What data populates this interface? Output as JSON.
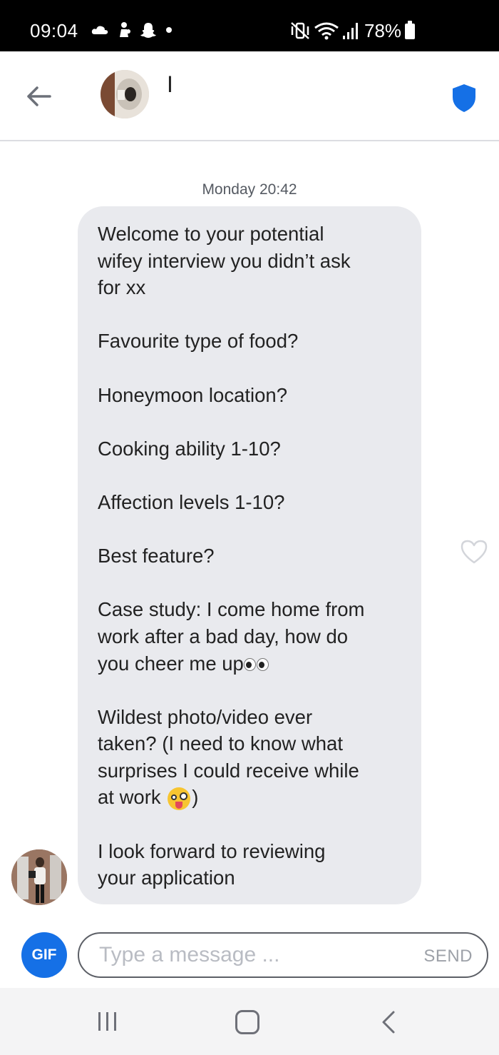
{
  "status_bar": {
    "time": "09:04",
    "battery": "78%",
    "left_icons": [
      "cloud-icon",
      "figure-icon",
      "snapchat-ghost-icon",
      "dot-icon"
    ],
    "right_icons": [
      "mute-vibrate-icon",
      "wifi-icon",
      "signal-icon",
      "battery-icon"
    ]
  },
  "header": {
    "contact_name": "I",
    "back_icon": "arrow-left-icon",
    "safety_icon": "shield-icon",
    "accent": "#1570e6"
  },
  "chat": {
    "timestamp": "Monday 20:42",
    "message_lines": [
      "Welcome to your potential",
      "wifey interview you didn’t ask",
      "for xx",
      "",
      "Favourite type of food?",
      "",
      "Honeymoon location?",
      "",
      "Cooking ability 1-10?",
      "",
      "Affection levels 1-10?",
      "",
      "Best feature?",
      "",
      "Case study: I come home from",
      "work after a bad day, how do",
      "you cheer me up",
      "",
      "Wildest photo/video ever",
      "taken? (I need to know what",
      "surprises I could receive while",
      "at work ",
      "",
      "I look forward to reviewing",
      "your application"
    ],
    "line_17_suffix_emoji": "eyes-emoji",
    "line_22_emoji": "zany-face-emoji",
    "line_22_tail": ")",
    "like_icon": "heart-outline-icon",
    "bubble_color": "#e9eaee"
  },
  "composer": {
    "gif_label": "GIF",
    "placeholder": "Type a message ...",
    "send_label": "SEND",
    "gif_color": "#1570e6"
  },
  "nav_bar": {
    "icons": [
      "recent-apps-icon",
      "home-icon",
      "back-icon"
    ]
  }
}
